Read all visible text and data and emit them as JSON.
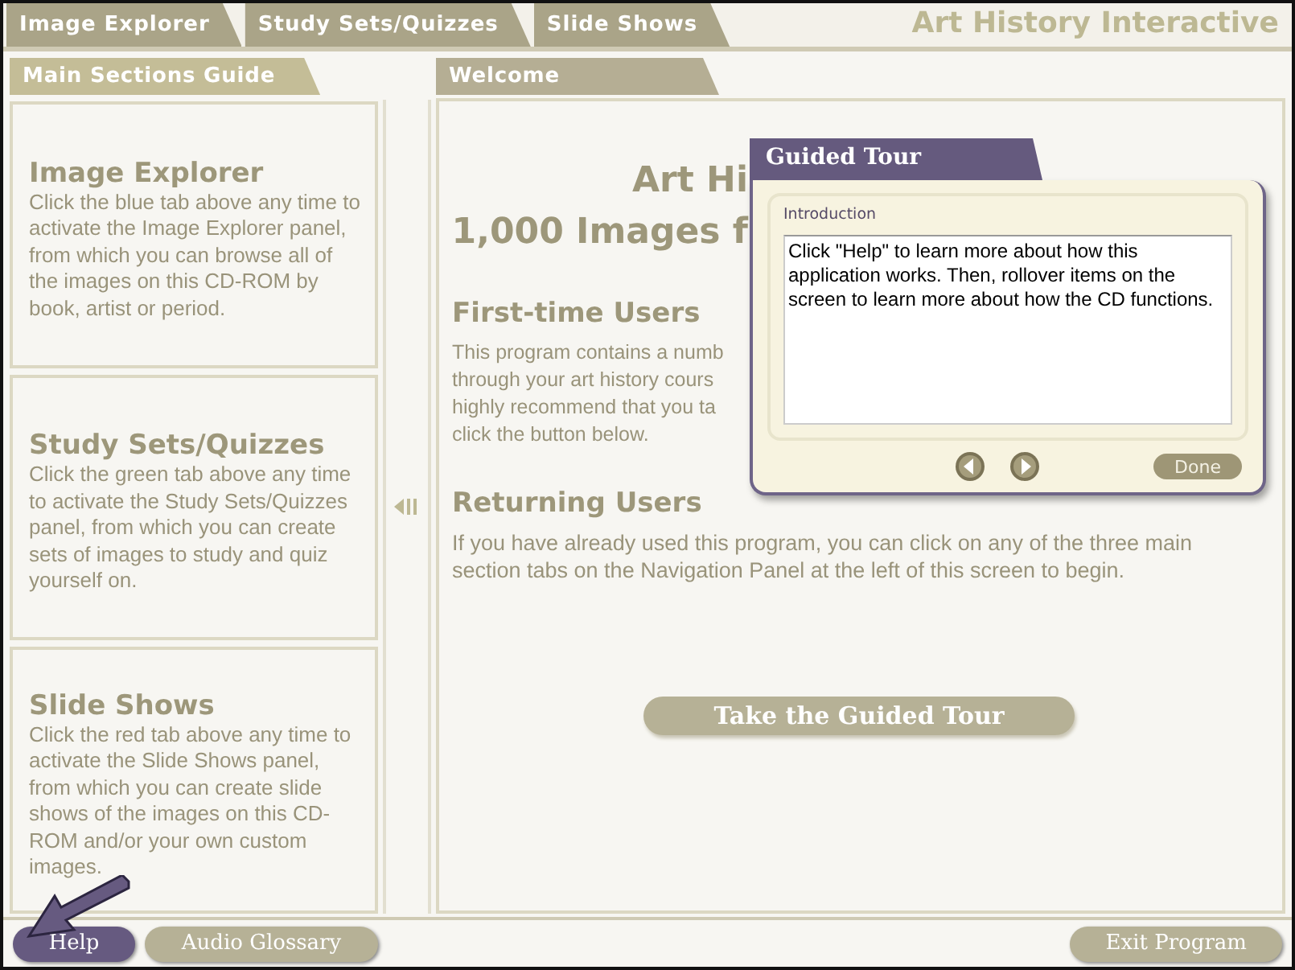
{
  "top_tabs": [
    {
      "label": "Image Explorer"
    },
    {
      "label": "Study Sets/Quizzes"
    },
    {
      "label": "Slide Shows"
    }
  ],
  "app_title": "Art History Interactive",
  "guide": {
    "tab": "Main Sections Guide",
    "sections": [
      {
        "heading": "Image Explorer",
        "text": "Click the blue tab above any time to activate the Image Explorer panel, from which you can browse all of the images on this CD-ROM by book, artist or period."
      },
      {
        "heading": "Study Sets/Quizzes",
        "text": "Click the green tab above any time to activate the Study Sets/Quizzes panel, from which you can create sets of images to study and quiz yourself on."
      },
      {
        "heading": "Slide Shows",
        "text": "Click the red tab above any time to activate the Slide Shows panel, from which you can create slide shows of the images on this CD-ROM and/or your own custom images."
      }
    ]
  },
  "welcome": {
    "tab": "Welcome",
    "title_lines": [
      "Art Hi",
      "1,000 Images f"
    ],
    "first_time": {
      "heading": "First-time Users",
      "lines": [
        "This program contains a numb",
        "through your art history cours",
        "highly recommend that you ta",
        "click the button below."
      ]
    },
    "returning": {
      "heading": "Returning Users",
      "text": "If you have already used this program, you can click on any of the three main section tabs on the Navigation Panel at the left of this screen to begin."
    },
    "tour_button": "Take the Guided Tour"
  },
  "tour_dialog": {
    "title": "Guided Tour",
    "section": "Introduction",
    "text": "Click \"Help\" to learn more about how this application works. Then, rollover items on the screen to learn more about how the CD functions.",
    "done": "Done"
  },
  "bottom_buttons": [
    {
      "label": "Help",
      "highlighted": true
    },
    {
      "label": "Audio Glossary",
      "highlighted": false
    }
  ],
  "exit_button": "Exit Program"
}
